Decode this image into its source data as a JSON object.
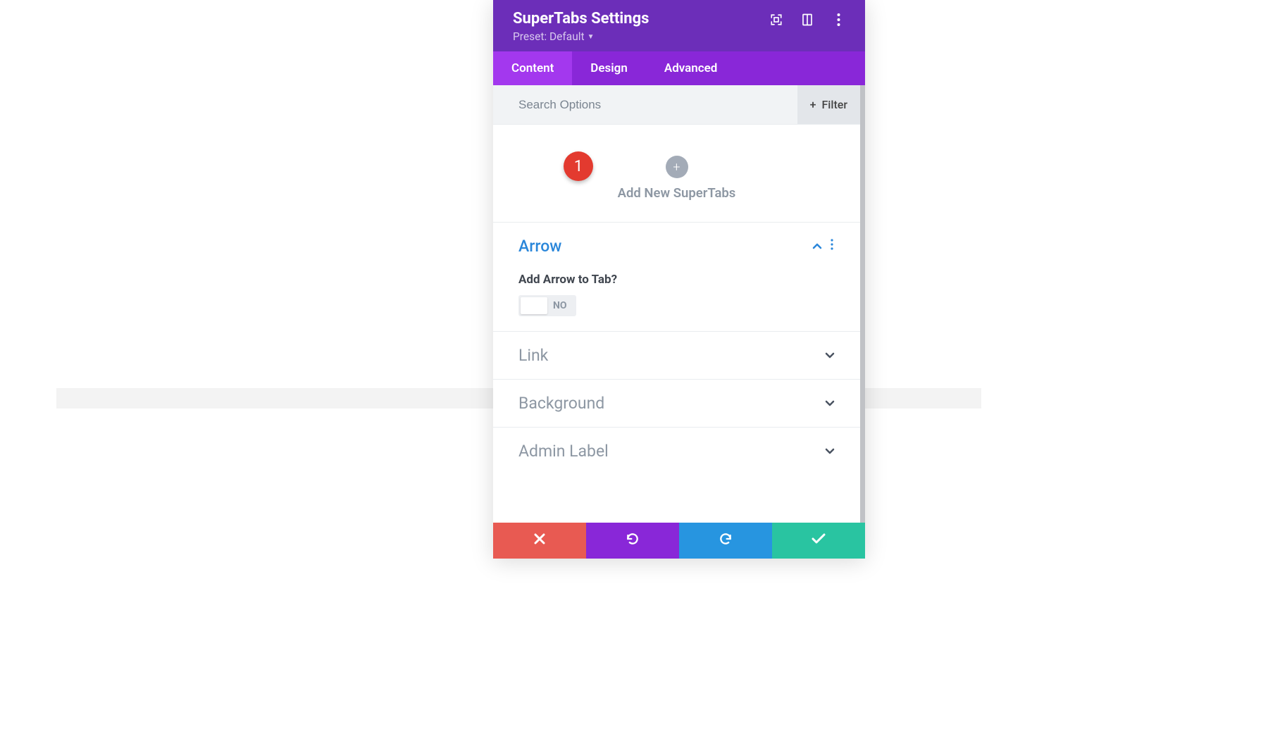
{
  "header": {
    "title": "SuperTabs Settings",
    "preset_label": "Preset: Default"
  },
  "tabs": [
    {
      "label": "Content",
      "active": true
    },
    {
      "label": "Design",
      "active": false
    },
    {
      "label": "Advanced",
      "active": false
    }
  ],
  "search": {
    "placeholder": "Search Options",
    "filter_label": "Filter"
  },
  "add": {
    "label": "Add New SuperTabs"
  },
  "callout": {
    "number": "1"
  },
  "sections": {
    "arrow": {
      "title": "Arrow",
      "field_label": "Add Arrow to Tab?",
      "toggle_value": "NO"
    },
    "link": {
      "title": "Link"
    },
    "background": {
      "title": "Background"
    },
    "admin_label": {
      "title": "Admin Label"
    }
  }
}
